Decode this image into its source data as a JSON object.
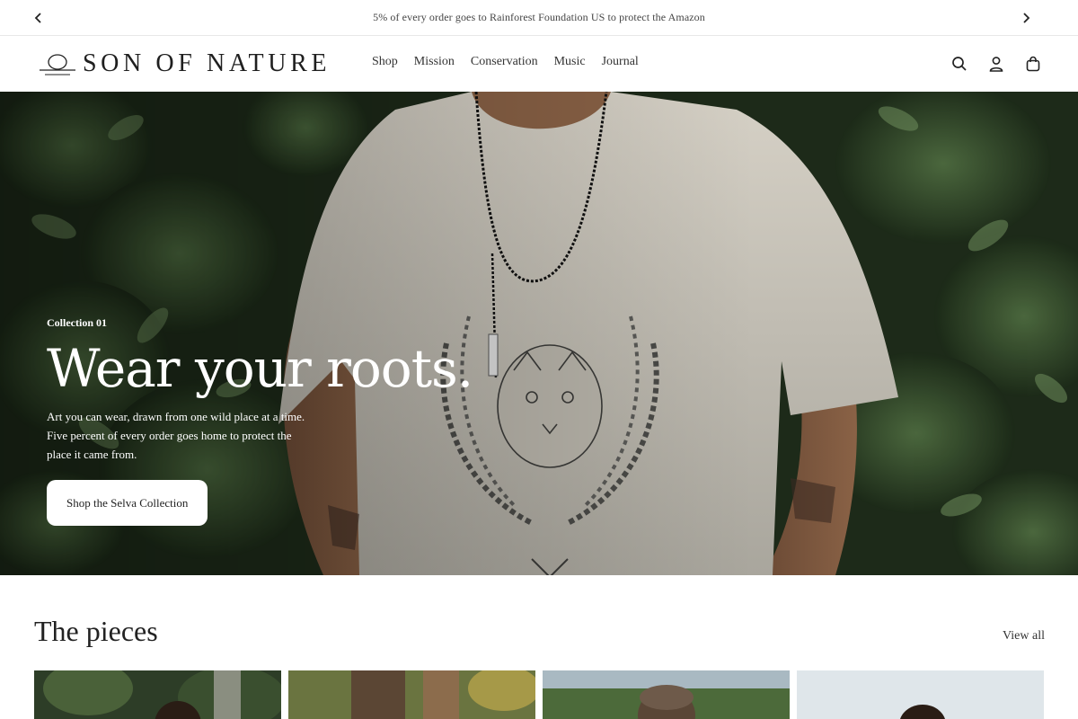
{
  "announcement": {
    "text": "5% of every order goes to Rainforest Foundation US to protect the Amazon",
    "prev_icon": "chevron-left-icon",
    "next_icon": "chevron-right-icon"
  },
  "header": {
    "logo_text": "SON OF NATURE",
    "nav": [
      "Shop",
      "Mission",
      "Conservation",
      "Music",
      "Journal"
    ],
    "icons": [
      "search-icon",
      "account-icon",
      "cart-bag-icon"
    ]
  },
  "hero": {
    "eyebrow": "Collection 01",
    "title": "Wear your roots.",
    "body": "Art you can wear, drawn from one wild place at a time. Five percent of every order goes home to protect the place it came from.",
    "cta_label": "Shop the Selva Collection"
  },
  "pieces": {
    "title": "The pieces",
    "view_all_label": "View all",
    "cards": [
      "product-card-1",
      "product-card-2",
      "product-card-3",
      "product-card-4"
    ]
  },
  "colors": {
    "announcement_bg": "#ffffff",
    "cta_bg": "#ffffff",
    "text": "#222222"
  }
}
